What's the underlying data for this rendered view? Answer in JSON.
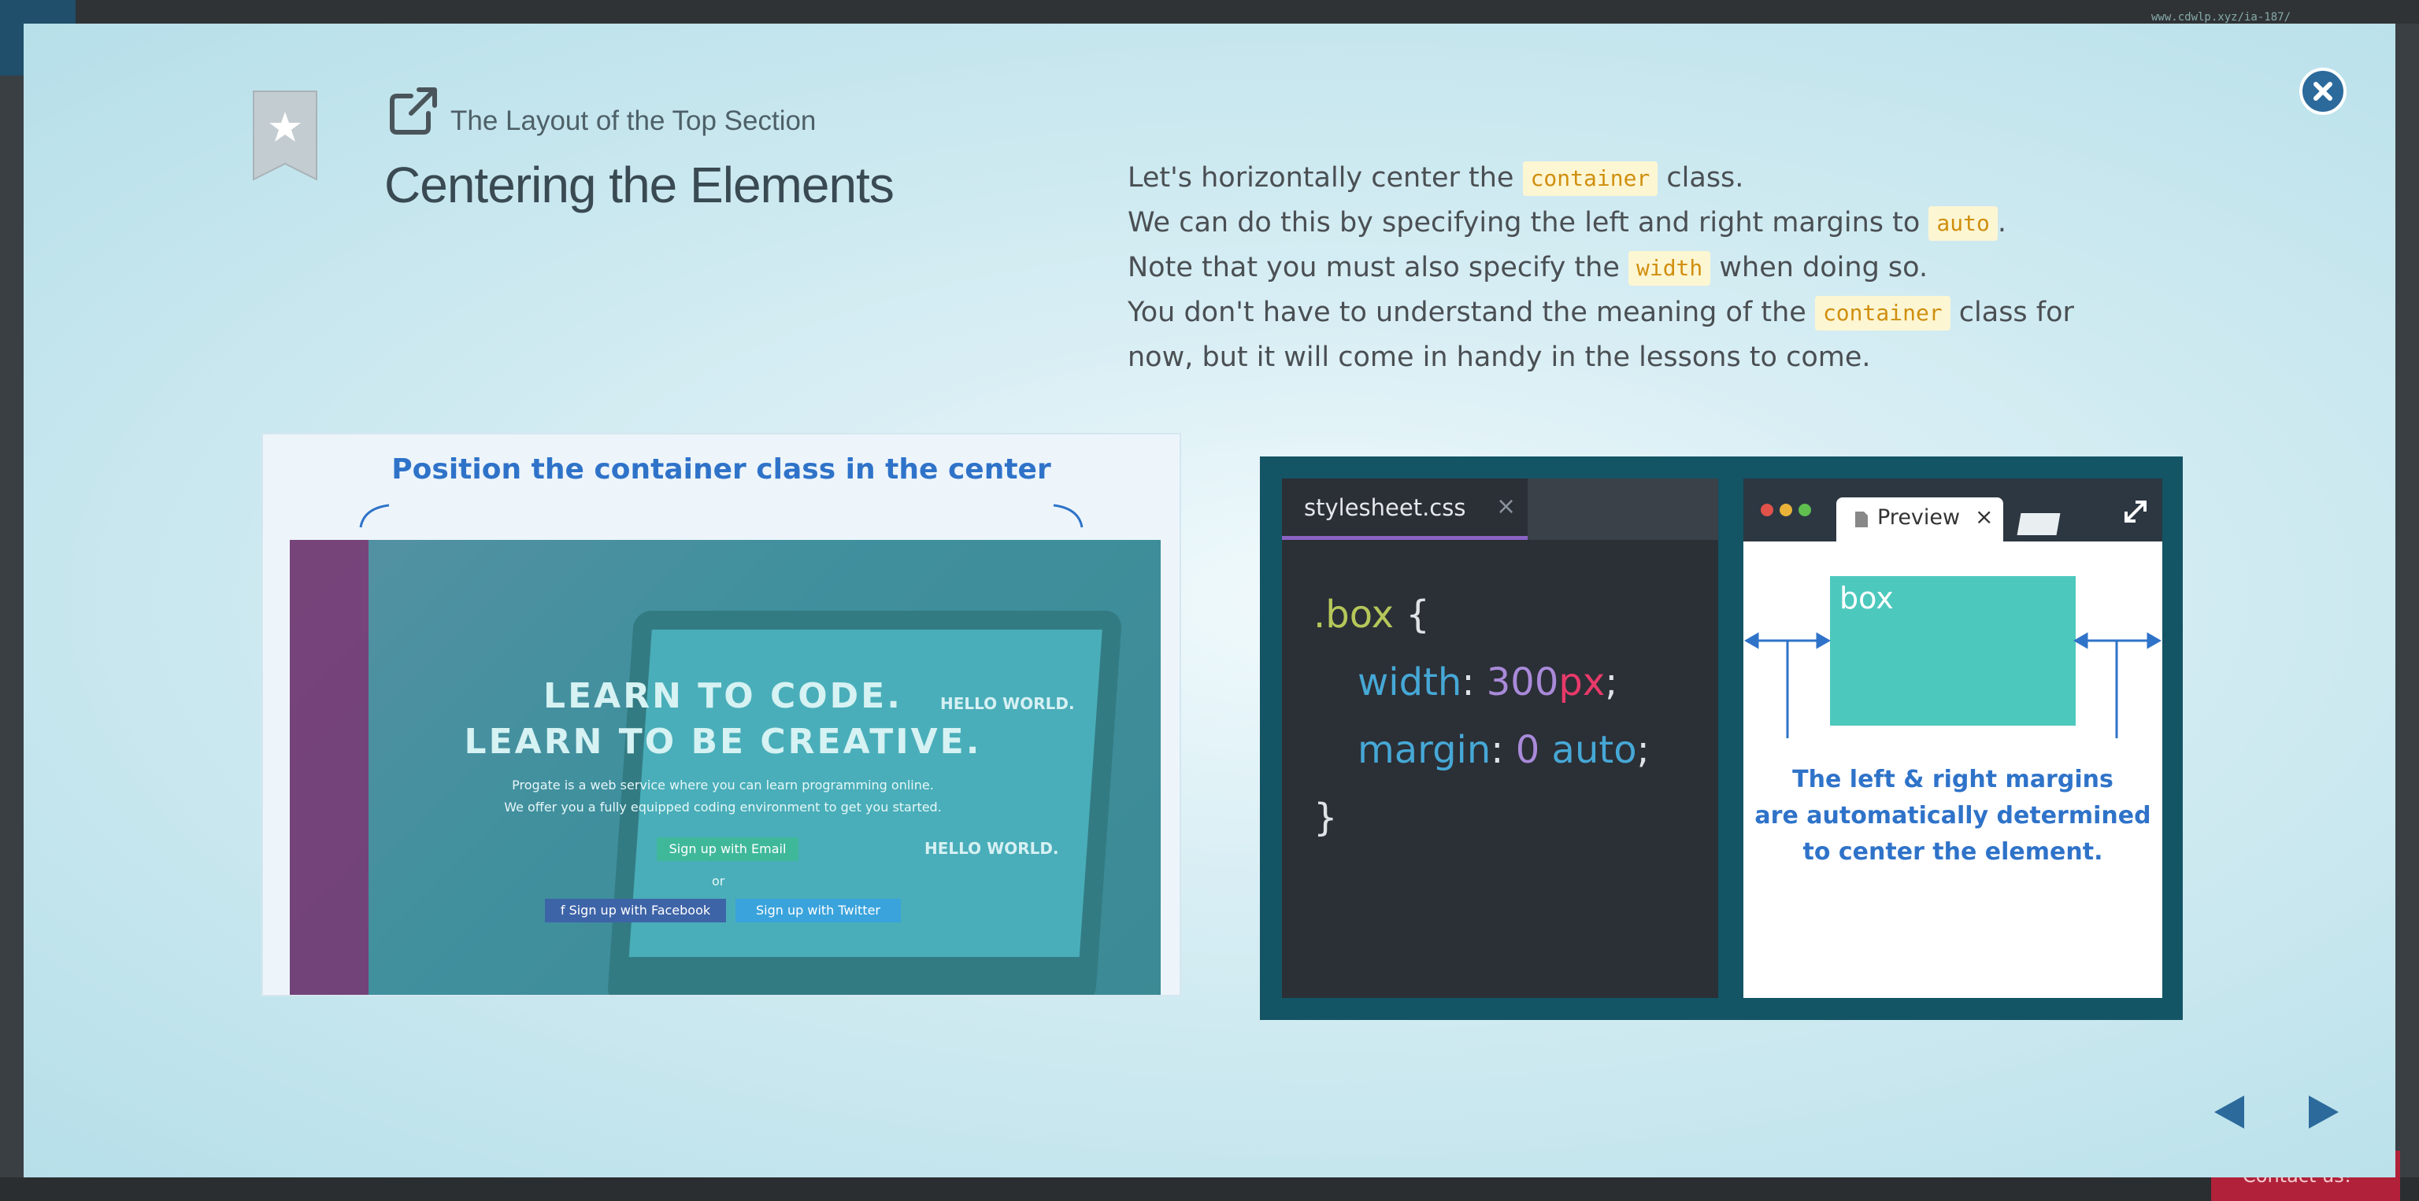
{
  "background": {
    "url_text": "www.cdwlp.xyz/ia-187/",
    "contact_label": "Contact us!"
  },
  "header": {
    "subtitle": "The Layout of the Top Section",
    "title": "Centering the Elements"
  },
  "description": {
    "line1": {
      "pre": "Let's horizontally center the ",
      "code": "container",
      "post": " class."
    },
    "line2": {
      "pre": "We can do this by specifying the left and right margins to ",
      "code": "auto",
      "post": "."
    },
    "line3": {
      "pre": "Note that you must also specify the ",
      "code": "width",
      "post": " when doing so."
    },
    "line4": {
      "pre": "You don't have to understand the meaning of the ",
      "code": "container",
      "post": " class for"
    },
    "line5": "now, but it will come in handy in the lessons to come."
  },
  "left_image": {
    "caption": "Position the container class in the center",
    "headline1": "LEARN TO CODE.",
    "headline2": "LEARN TO BE CREATIVE.",
    "sub1": "Progate is a web service where you can learn programming online.",
    "sub2": "We offer you a fully equipped coding environment to get you started.",
    "btn_email": "Sign up with Email",
    "or": "or",
    "btn_facebook": "f  Sign up with Facebook",
    "btn_twitter": "Sign up with Twitter",
    "hello1": "HELLO WORLD.",
    "hello2": "HELLO WORLD."
  },
  "right_image": {
    "editor_tab": "stylesheet.css",
    "editor_tab_close": "×",
    "code": {
      "selector": ".box",
      "open": " {",
      "prop1": "width",
      "val1_num": "300",
      "val1_unit": "px",
      "prop2": "margin",
      "val2_num": "0",
      "val2_kw": "auto",
      "close": "}"
    },
    "preview_tab": "Preview",
    "preview_tab_close": "×",
    "box_label": "box",
    "note_line1": "The left & right margins",
    "note_line2": "are automatically determined",
    "note_line3": "to center the element."
  },
  "colors": {
    "accent_blue": "#2f73c9",
    "close_button": "#2c6a9c",
    "code_tag_bg": "#fdf6d3",
    "code_tag_text": "#d08f0f",
    "box_fill": "#4dc8bd"
  },
  "icons": {
    "close": "close-icon",
    "bookmark": "bookmark-star-icon",
    "external": "external-link-icon",
    "prev": "prev-arrow-icon",
    "next": "next-arrow-icon"
  }
}
